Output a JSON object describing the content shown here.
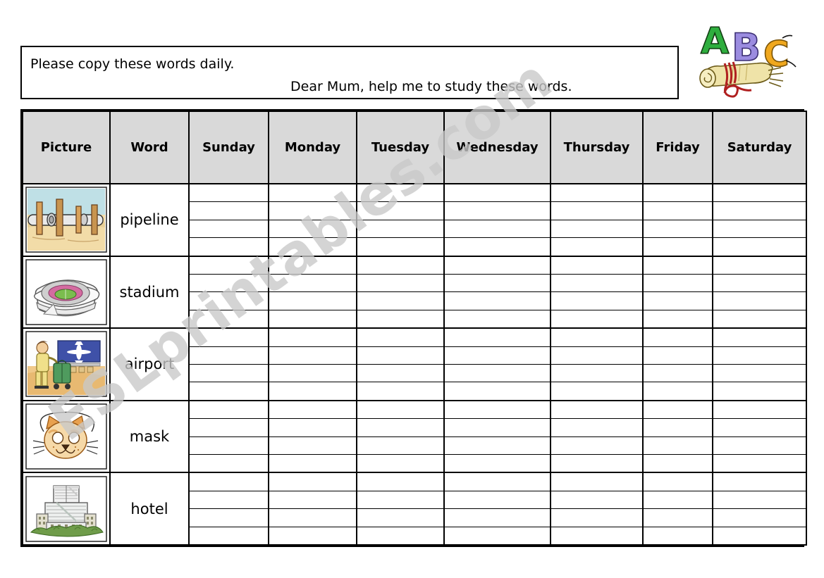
{
  "instructions": {
    "line1": "Please copy these words daily.",
    "line2": "Dear Mum, help me to study these words."
  },
  "clipart": {
    "name": "abc-scroll-clipart",
    "letters": [
      "A",
      "B",
      "C"
    ],
    "letter_colors": [
      "#2eae3e",
      "#9b8ce0",
      "#f0a81e"
    ],
    "scroll_color": "#efe3a8",
    "ribbon_color": "#b02020"
  },
  "watermark": {
    "text": "ESLprintables.com",
    "color": "#c9c9c9"
  },
  "table": {
    "headers": [
      "Picture",
      "Word",
      "Sunday",
      "Monday",
      "Tuesday",
      "Wednesday",
      "Thursday",
      "Friday",
      "Saturday"
    ],
    "header_background": "#d9d9d9",
    "lines_per_cell": 4,
    "rows": [
      {
        "word": "pipeline",
        "picture": "pipeline-image"
      },
      {
        "word": "stadium",
        "picture": "stadium-image"
      },
      {
        "word": "airport",
        "picture": "airport-image"
      },
      {
        "word": "mask",
        "picture": "mask-image"
      },
      {
        "word": "hotel",
        "picture": "hotel-image"
      }
    ]
  }
}
